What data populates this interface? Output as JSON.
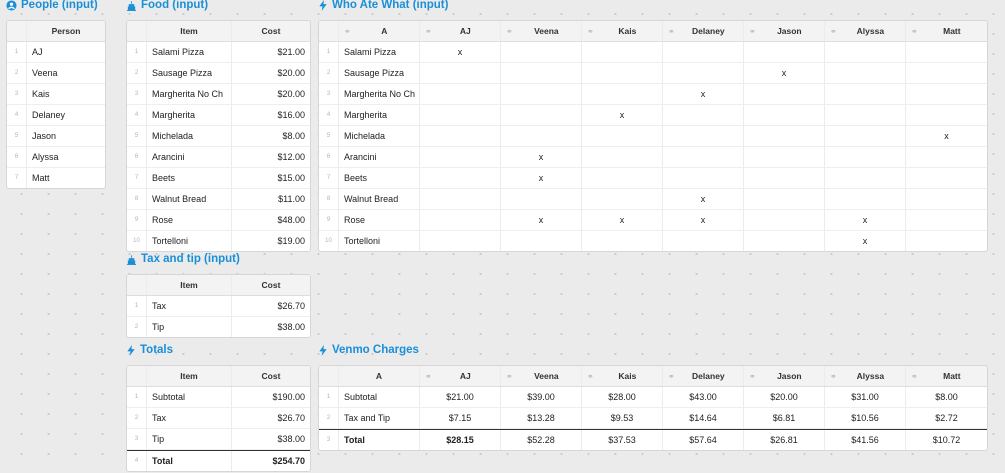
{
  "people": {
    "title": "People (input)",
    "header": "Person",
    "rows": [
      "AJ",
      "Veena",
      "Kais",
      "Delaney",
      "Jason",
      "Alyssa",
      "Matt"
    ]
  },
  "food": {
    "title": "Food (input)",
    "headers": [
      "Item",
      "Cost"
    ],
    "rows": [
      {
        "item": "Salami Pizza",
        "cost": "$21.00"
      },
      {
        "item": "Sausage Pizza",
        "cost": "$20.00"
      },
      {
        "item": "Margherita No Ch",
        "cost": "$20.00"
      },
      {
        "item": "Margherita",
        "cost": "$16.00"
      },
      {
        "item": "Michelada",
        "cost": "$8.00"
      },
      {
        "item": "Arancini",
        "cost": "$12.00"
      },
      {
        "item": "Beets",
        "cost": "$15.00"
      },
      {
        "item": "Walnut Bread",
        "cost": "$11.00"
      },
      {
        "item": "Rose",
        "cost": "$48.00"
      },
      {
        "item": "Tortelloni",
        "cost": "$19.00"
      }
    ]
  },
  "who": {
    "title": "Who Ate What (input)",
    "headers": [
      "A",
      "AJ",
      "Veena",
      "Kais",
      "Delaney",
      "Jason",
      "Alyssa",
      "Matt"
    ],
    "rows": [
      {
        "item": "Salami Pizza",
        "marks": [
          "x",
          "",
          "",
          "",
          "",
          "",
          ""
        ]
      },
      {
        "item": "Sausage Pizza",
        "marks": [
          "",
          "",
          "",
          "",
          "x",
          "",
          ""
        ]
      },
      {
        "item": "Margherita No Ch",
        "marks": [
          "",
          "",
          "",
          "x",
          "",
          "",
          ""
        ]
      },
      {
        "item": "Margherita",
        "marks": [
          "",
          "",
          "x",
          "",
          "",
          "",
          ""
        ]
      },
      {
        "item": "Michelada",
        "marks": [
          "",
          "",
          "",
          "",
          "",
          "",
          "x"
        ]
      },
      {
        "item": "Arancini",
        "marks": [
          "",
          "x",
          "",
          "",
          "",
          "",
          ""
        ]
      },
      {
        "item": "Beets",
        "marks": [
          "",
          "x",
          "",
          "",
          "",
          "",
          ""
        ]
      },
      {
        "item": "Walnut Bread",
        "marks": [
          "",
          "",
          "",
          "x",
          "",
          "",
          ""
        ]
      },
      {
        "item": "Rose",
        "marks": [
          "",
          "x",
          "x",
          "x",
          "",
          "x",
          ""
        ]
      },
      {
        "item": "Tortelloni",
        "marks": [
          "",
          "",
          "",
          "",
          "",
          "x",
          ""
        ]
      }
    ]
  },
  "tax": {
    "title": "Tax and tip (input)",
    "headers": [
      "Item",
      "Cost"
    ],
    "rows": [
      {
        "item": "Tax",
        "cost": "$26.70"
      },
      {
        "item": "Tip",
        "cost": "$38.00"
      }
    ]
  },
  "totals": {
    "title": "Totals",
    "headers": [
      "Item",
      "Cost"
    ],
    "rows": [
      {
        "item": "Subtotal",
        "cost": "$190.00"
      },
      {
        "item": "Tax",
        "cost": "$26.70"
      },
      {
        "item": "Tip",
        "cost": "$38.00"
      },
      {
        "item": "Total",
        "cost": "$254.70"
      }
    ]
  },
  "venmo": {
    "title": "Venmo Charges",
    "headers": [
      "A",
      "AJ",
      "Veena",
      "Kais",
      "Delaney",
      "Jason",
      "Alyssa",
      "Matt"
    ],
    "rows": [
      {
        "item": "Subtotal",
        "values": [
          "$21.00",
          "$39.00",
          "$28.00",
          "$43.00",
          "$20.00",
          "$31.00",
          "$8.00"
        ]
      },
      {
        "item": "Tax and Tip",
        "values": [
          "$7.15",
          "$13.28",
          "$9.53",
          "$14.64",
          "$6.81",
          "$10.56",
          "$2.72"
        ]
      },
      {
        "item": "Total",
        "values": [
          "$28.15",
          "$52.28",
          "$37.53",
          "$57.64",
          "$26.81",
          "$41.56",
          "$10.72"
        ]
      }
    ]
  },
  "icons": {
    "people": "person-circle-icon",
    "input_table": "cake-icon",
    "formula": "lightning-bolt-icon",
    "column_link": "link-icon"
  },
  "colors": {
    "accent": "#1a8fd8",
    "canvas": "#ebebeb",
    "header_bg": "#f3f3f3"
  }
}
